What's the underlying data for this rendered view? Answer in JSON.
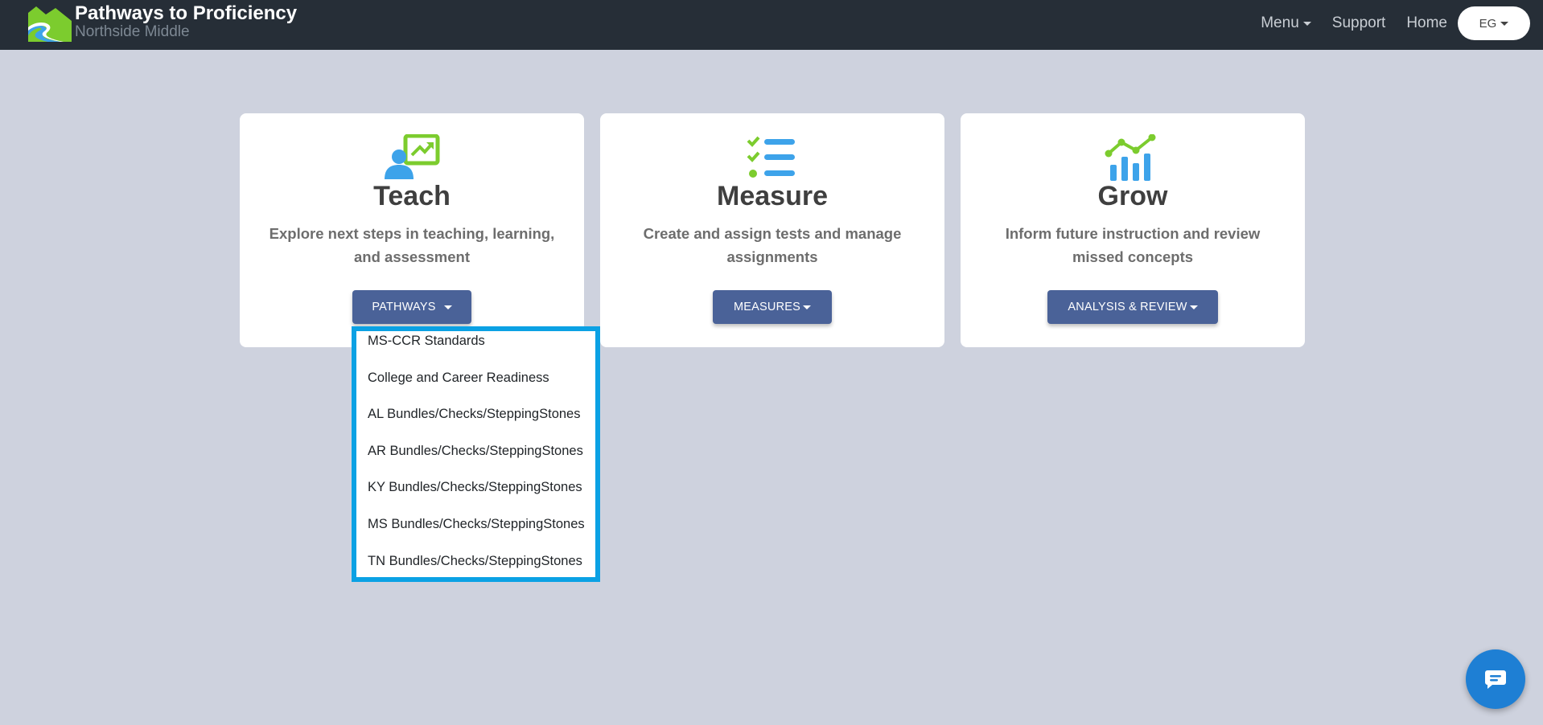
{
  "navbar": {
    "title": "Pathways to Proficiency",
    "subtitle": "Northside Middle",
    "links": {
      "menu": "Menu",
      "support": "Support",
      "home": "Home"
    },
    "language": "EG"
  },
  "cards": [
    {
      "title": "Teach",
      "description": "Explore next steps in teaching, learning, and assessment",
      "button": "PATHWAYS",
      "icon": "teacher-presentation-icon"
    },
    {
      "title": "Measure",
      "description": "Create and assign tests and manage assignments",
      "button": "MEASURES",
      "icon": "checklist-icon"
    },
    {
      "title": "Grow",
      "description": "Inform future instruction and review missed concepts",
      "button": "ANALYSIS & REVIEW",
      "icon": "growth-chart-icon"
    }
  ],
  "dropdown": {
    "items": [
      "MS-CCR Standards",
      "College and Career Readiness",
      "AL Bundles/Checks/SteppingStones",
      "AR Bundles/Checks/SteppingStones",
      "KY Bundles/Checks/SteppingStones",
      "MS Bundles/Checks/SteppingStones",
      "TN Bundles/Checks/SteppingStones"
    ]
  },
  "colors": {
    "navbar": "#262e37",
    "background": "#ced2de",
    "button": "#4a6298",
    "dropdown_border": "#0ba1e4",
    "icon_blue": "#3da3ea",
    "icon_green": "#7ccc2e",
    "chat": "#1e7fd4"
  },
  "chat": {
    "icon": "chat-bubble-icon"
  }
}
